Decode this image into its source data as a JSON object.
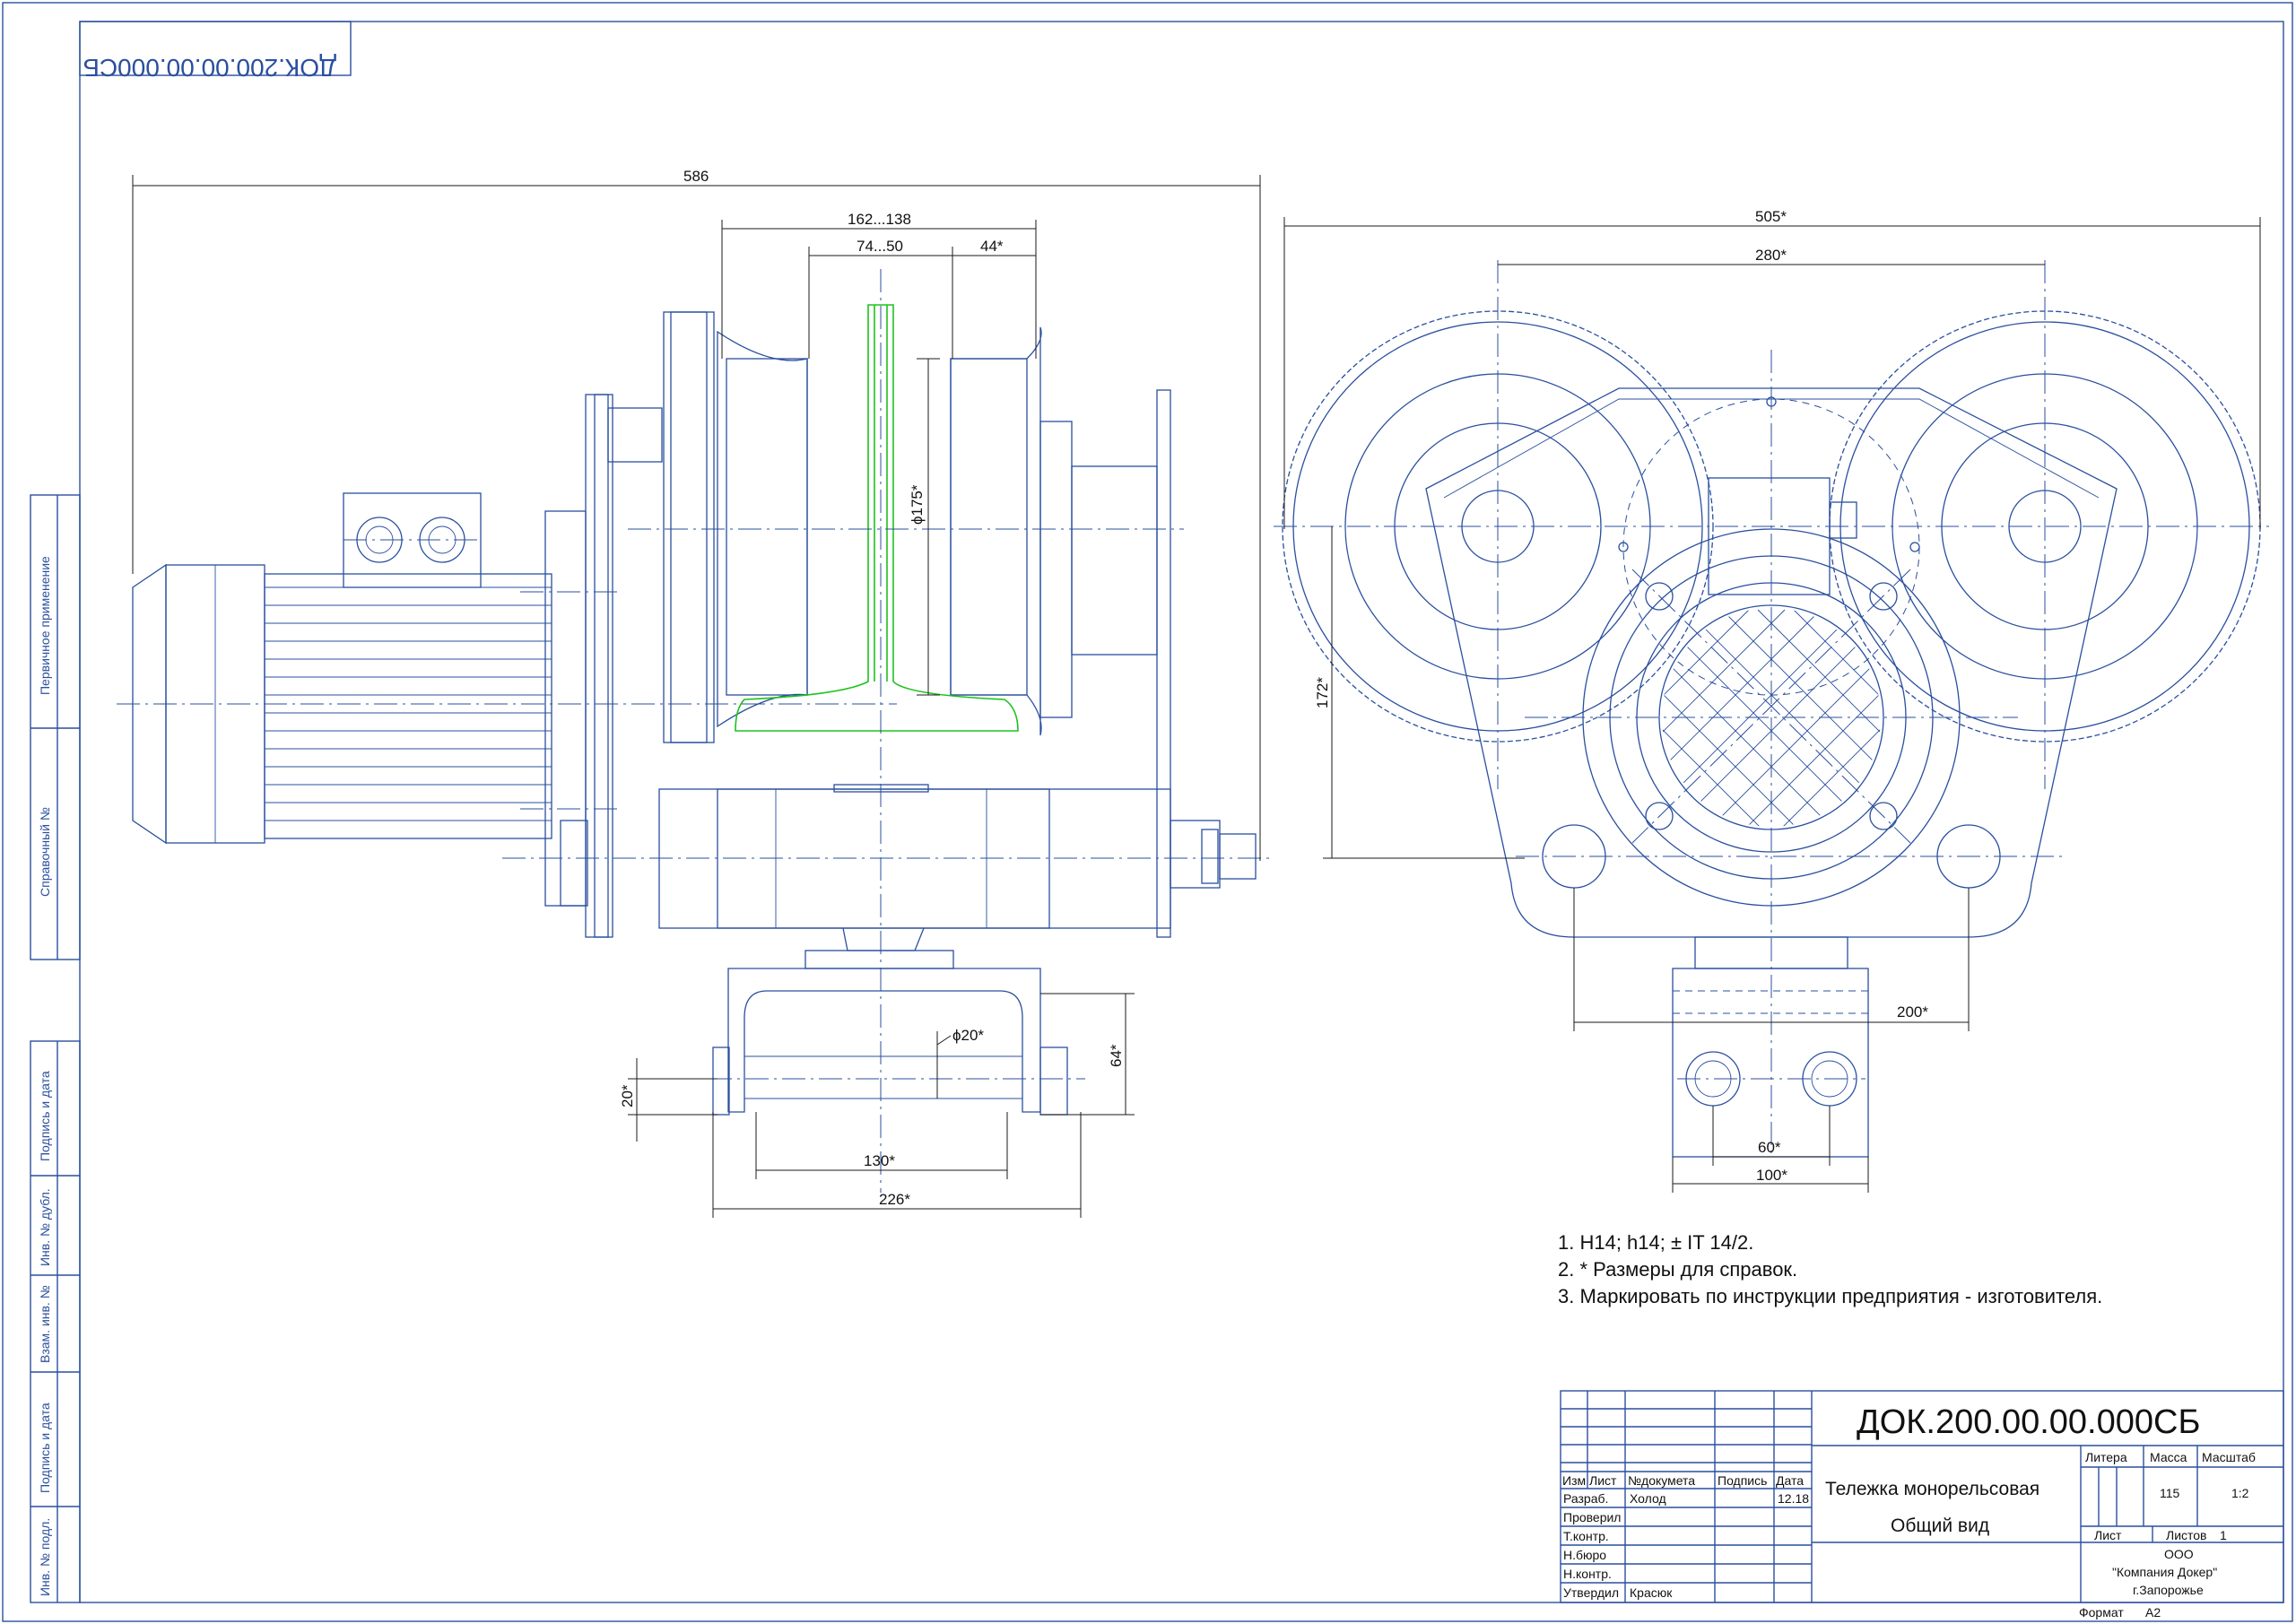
{
  "drawing_number": "ДОК.200.00.00.000СБ",
  "title_line1": "Тележка монорельсовая",
  "title_line2": "Общий вид",
  "notes": [
    "1. H14; h14; ± IT 14/2.",
    "2. * Размеры для справок.",
    "3. Маркировать по инструкции предприятия - изготовителя."
  ],
  "dimensions": {
    "overall_length": "586",
    "wheel_track": "162...138",
    "flange_width": "74...50",
    "offset": "44*",
    "wheel_dia": "ϕ175*",
    "pin_dia": "ϕ20*",
    "hanger_height": "20*",
    "hanger_depth": "64*",
    "hanger_inner": "130*",
    "hanger_outer": "226*",
    "overall_width": "505*",
    "axle_spacing": "280*",
    "height": "172*",
    "plate_width": "200*",
    "bolt_spacing": "60*",
    "block_width": "100*"
  },
  "title_block": {
    "headers": {
      "izm": "Изм",
      "list": "Лист",
      "doc": "№докумета",
      "sign": "Подпись",
      "date": "Дата"
    },
    "rows": [
      {
        "role": "Разраб.",
        "name": "Холод",
        "date": "12.18"
      },
      {
        "role": "Проверил",
        "name": "",
        "date": ""
      },
      {
        "role": "Т.контр.",
        "name": "",
        "date": ""
      },
      {
        "role": "Н.бюро",
        "name": "",
        "date": ""
      },
      {
        "role": "Н.контр.",
        "name": "",
        "date": ""
      },
      {
        "role": "Утвердил",
        "name": "Красюк",
        "date": ""
      }
    ],
    "litera_label": "Литера",
    "mass_label": "Масса",
    "scale_label": "Масштаб",
    "mass": "115",
    "scale": "1:2",
    "sheet_label": "Лист",
    "sheets_label": "Листов",
    "sheets": "1",
    "company_line1": "ООО",
    "company_line2": "\"Компания Докер\"",
    "company_line3": "г.Запорожье",
    "format_label": "Формат",
    "format_value": "А2"
  },
  "side_strip": {
    "first_use": "Первичное    применение",
    "reference": "Справочный    №",
    "sign_date_1": "Подпись  и  дата",
    "dup_inv": "Инв. №  дубл.",
    "replace_inv": "Взам. инв. №",
    "sign_date_2": "Подпись  и  дата",
    "orig_inv": "Инв. №  подл."
  }
}
